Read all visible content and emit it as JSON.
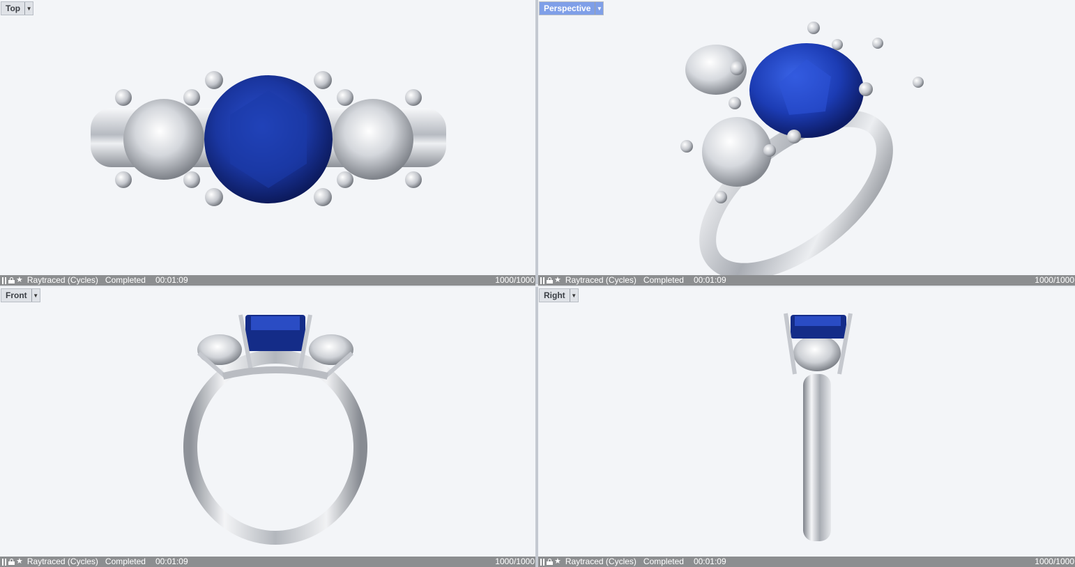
{
  "viewports": {
    "top": {
      "title": "Top",
      "status": {
        "renderer": "Raytraced (Cycles)",
        "state": "Completed",
        "elapsed": "00:01:09",
        "passes": "1000/1000"
      }
    },
    "perspective": {
      "title": "Perspective",
      "active": true,
      "status": {
        "renderer": "Raytraced (Cycles)",
        "state": "Completed",
        "elapsed": "00:01:09",
        "passes": "1000/1000"
      }
    },
    "front": {
      "title": "Front",
      "status": {
        "renderer": "Raytraced (Cycles)",
        "state": "Completed",
        "elapsed": "00:01:09",
        "passes": "1000/1000"
      }
    },
    "right": {
      "title": "Right",
      "status": {
        "renderer": "Raytraced (Cycles)",
        "state": "Completed",
        "elapsed": "00:01:09",
        "passes": "1000/1000"
      }
    }
  },
  "icons": [
    "pause-icon",
    "lock-icon",
    "star-icon",
    "chevron-down-icon"
  ],
  "colors": {
    "active_tab": "#7f9fe8",
    "status_bar": "#8c8e90",
    "viewport_bg": "#f3f5f8",
    "sapphire": "#1e3fae",
    "metal": "#c9ccd2"
  }
}
